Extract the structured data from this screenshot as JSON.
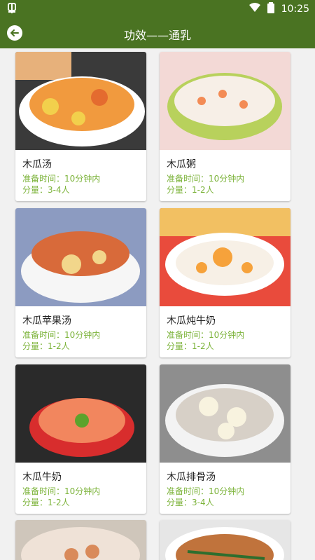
{
  "status": {
    "time": "10:25",
    "left_icon": "bug-icon"
  },
  "header": {
    "title": "功效——通乳",
    "back_icon": "back-arrow-icon"
  },
  "recipes": [
    {
      "name": "木瓜汤",
      "time": "准备时间：10分钟内",
      "serving": "分量：3-4人"
    },
    {
      "name": "木瓜粥",
      "time": "准备时间：10分钟内",
      "serving": "分量：1-2人"
    },
    {
      "name": "木瓜苹果汤",
      "time": "准备时间：10分钟内",
      "serving": "分量：1-2人"
    },
    {
      "name": "木瓜炖牛奶",
      "time": "准备时间：10分钟内",
      "serving": "分量：1-2人"
    },
    {
      "name": "木瓜牛奶",
      "time": "准备时间：10分钟内",
      "serving": "分量：1-2人"
    },
    {
      "name": "木瓜排骨汤",
      "time": "准备时间：10分钟内",
      "serving": "分量：3-4人"
    }
  ],
  "colors": {
    "primary": "#4a7322",
    "accent_text": "#7cb33a"
  }
}
